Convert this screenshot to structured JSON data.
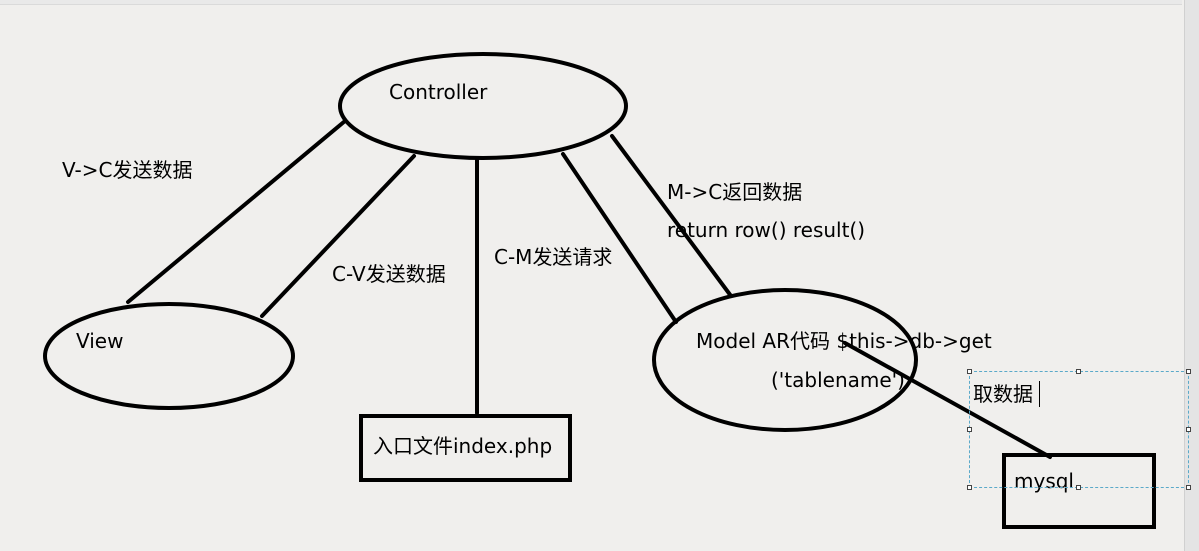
{
  "nodes": {
    "controller": "Controller",
    "view": "View",
    "model_line1": "Model AR代码 $this->db->get",
    "model_line2": "('tablename')",
    "entry": "入口文件index.php",
    "mysql": "mysql"
  },
  "edges": {
    "v_to_c": "V->C发送数据",
    "c_to_v": "C-V发送数据",
    "c_to_m": "C-M发送请求",
    "m_to_c_line1": "M->C返回数据",
    "m_to_c_line2": "return row() result()",
    "fetch": "取数据"
  },
  "colors": {
    "background": "#f0efed",
    "stroke": "#000000",
    "selection": "#5aa9c9"
  }
}
